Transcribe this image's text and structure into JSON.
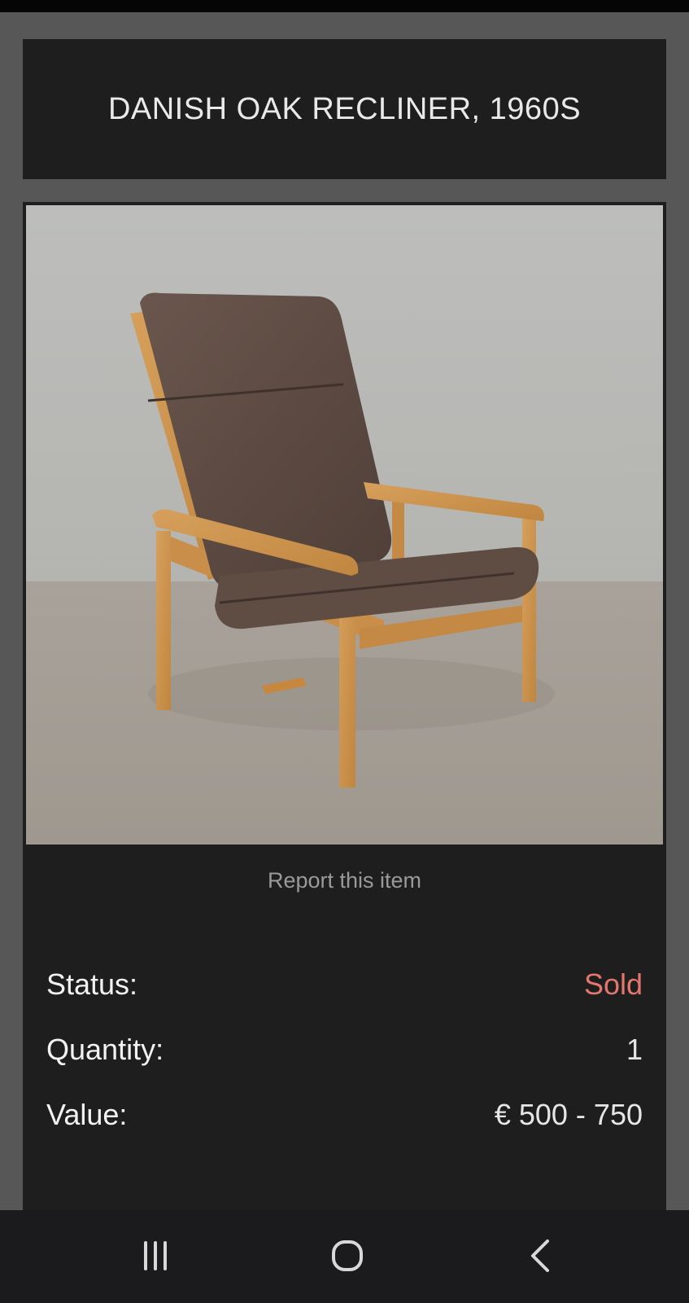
{
  "item": {
    "title": "DANISH OAK RECLINER, 1960S",
    "report_label": "Report this item",
    "details": {
      "status_label": "Status:",
      "status_value": "Sold",
      "quantity_label": "Quantity:",
      "quantity_value": "1",
      "value_label": "Value:",
      "value_value": "€ 500 - 750"
    }
  },
  "colors": {
    "page_background": "#575757",
    "card_background": "#1e1e1f",
    "sold_status": "#e4776d",
    "secondary_text": "#9a9a9a"
  },
  "nav_bar": {
    "buttons": [
      "recent-apps-icon",
      "home-icon",
      "back-icon"
    ]
  }
}
